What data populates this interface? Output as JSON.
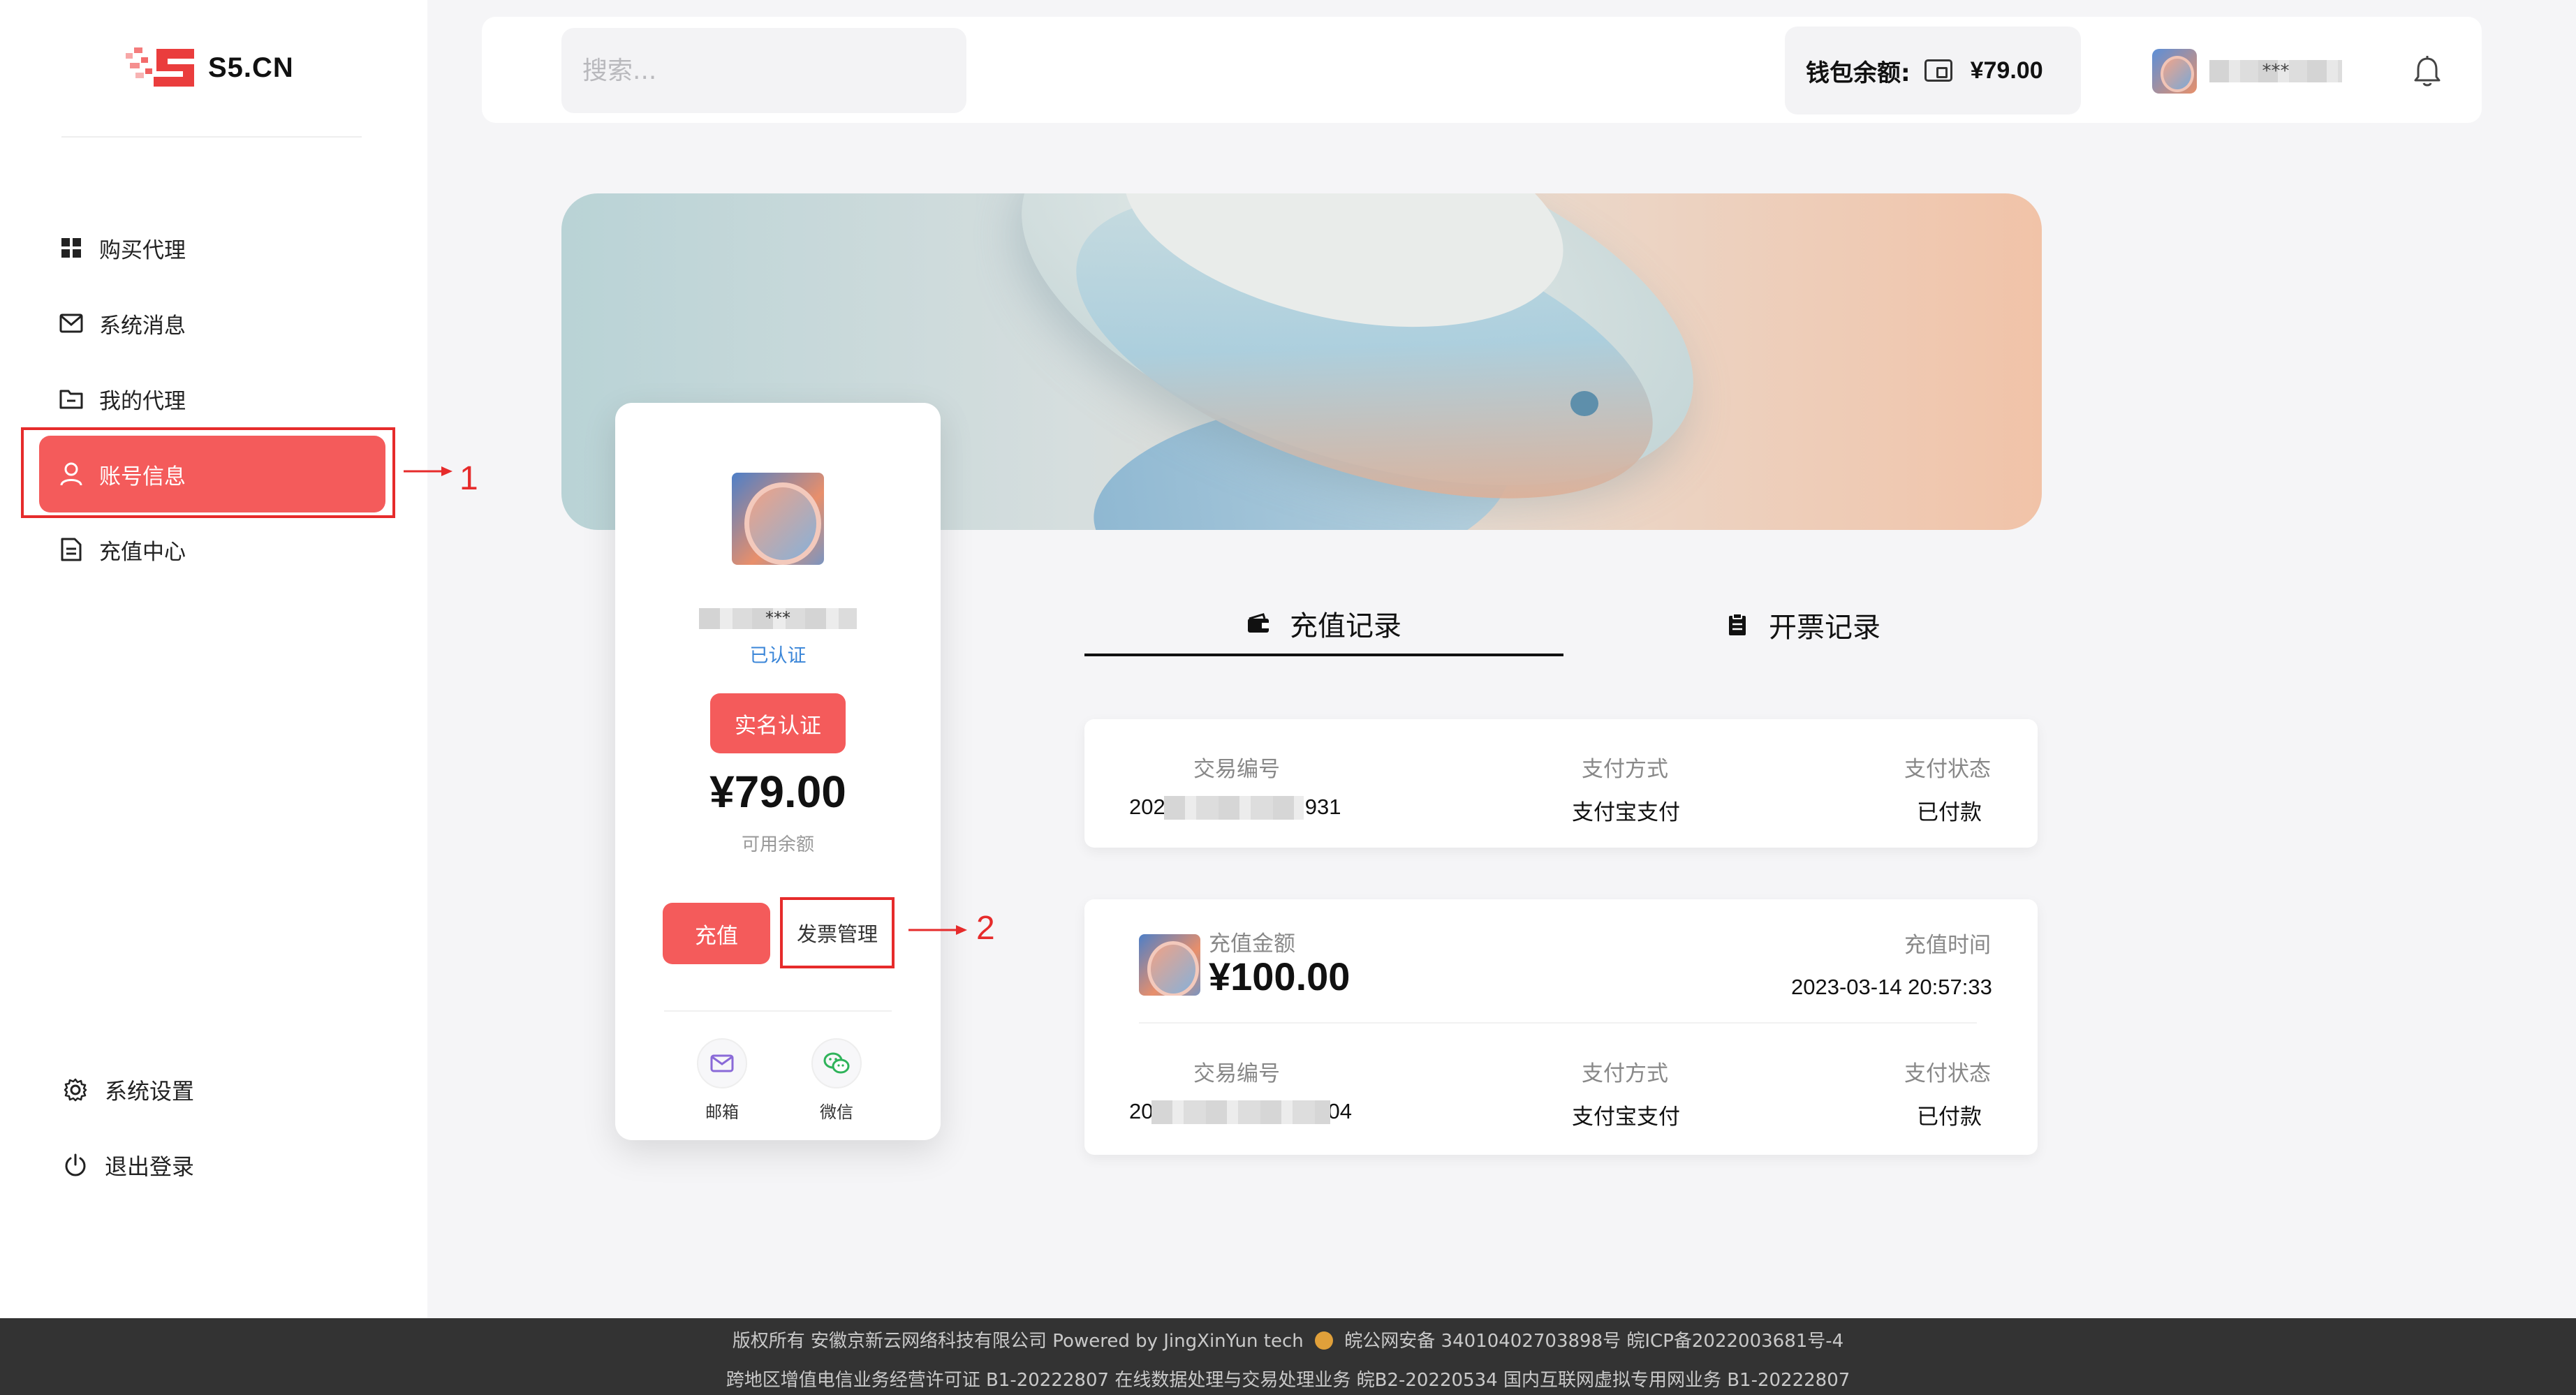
{
  "app": {
    "logo_text": "S5.CN"
  },
  "sidebar": {
    "items": [
      {
        "label": "购买代理",
        "icon": "grid-icon"
      },
      {
        "label": "系统消息",
        "icon": "mail-icon"
      },
      {
        "label": "我的代理",
        "icon": "folder-icon"
      },
      {
        "label": "账号信息",
        "icon": "user-icon",
        "active": true
      },
      {
        "label": "充值中心",
        "icon": "document-icon"
      }
    ],
    "bottom": [
      {
        "label": "系统设置",
        "icon": "gear-icon"
      },
      {
        "label": "退出登录",
        "icon": "power-icon"
      }
    ]
  },
  "header": {
    "search_placeholder": "搜索...",
    "wallet_label": "钱包余额:",
    "wallet_value": "¥79.00",
    "username": "***"
  },
  "profile": {
    "username": "***",
    "verified": "已认证",
    "realname_button": "实名认证",
    "balance": "¥79.00",
    "balance_label": "可用余额",
    "recharge_button": "充值",
    "invoice_button": "发票管理",
    "contacts": [
      {
        "label": "邮箱",
        "icon": "mail-icon"
      },
      {
        "label": "微信",
        "icon": "wechat-icon"
      }
    ]
  },
  "annotations": {
    "label1": "1",
    "label2": "2",
    "color": "#e62b2b"
  },
  "tabs": [
    {
      "label": "充值记录",
      "icon": "wallet-icon",
      "active": true
    },
    {
      "label": "开票记录",
      "icon": "clipboard-icon",
      "active": false
    }
  ],
  "records": {
    "labels": {
      "tx_id": "交易编号",
      "pay_method": "支付方式",
      "pay_status": "支付状态",
      "amount": "充值金额",
      "time": "充值时间"
    },
    "first": {
      "tx_prefix": "202",
      "tx_suffix": "931",
      "pay_method": "支付宝支付",
      "pay_status": "已付款"
    },
    "second": {
      "amount": "¥100.00",
      "time": "2023-03-14 20:57:33",
      "tx_prefix": "20",
      "tx_suffix": "04",
      "pay_method": "支付宝支付",
      "pay_status": "已付款"
    }
  },
  "footer": {
    "line1": "版权所有 安徽京新云网络科技有限公司 Powered by JingXinYun tech",
    "line1_b": "皖公网安备 34010402703898号 皖ICP备2022003681号-4",
    "line2": "跨地区增值电信业务经营许可证 B1-20222807 在线数据处理与交易处理业务 皖B2-20220534 国内互联网虚拟专用网业务 B1-20222807"
  },
  "colors": {
    "accent": "#f45b5b",
    "link": "#3b86d8",
    "footer_bg": "#333333"
  }
}
